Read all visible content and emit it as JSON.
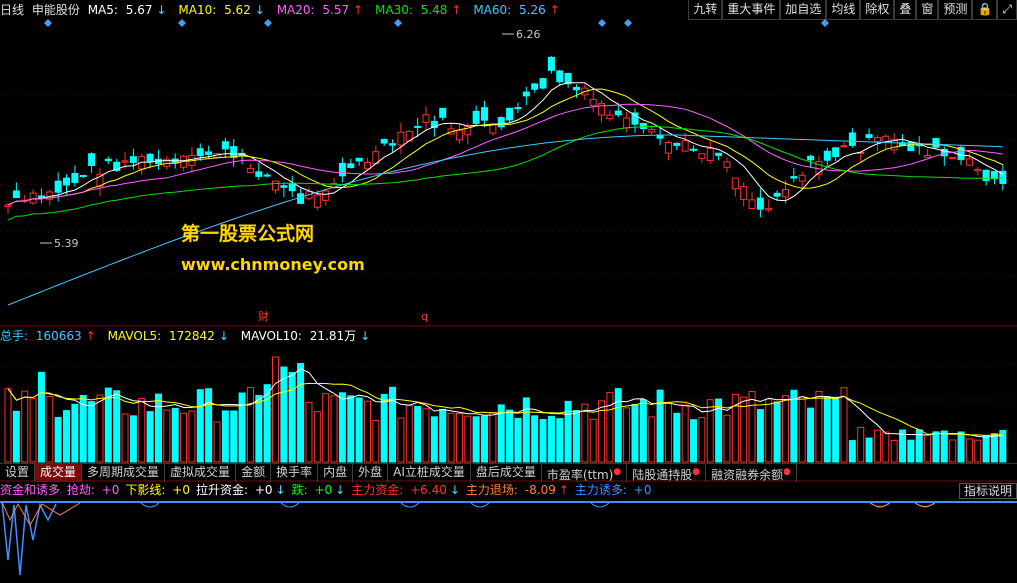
{
  "header": {
    "period": "日线",
    "stock_name": "申能股份",
    "ma5": {
      "label": "MA5:",
      "value": "5.67",
      "arrow": "↓",
      "color": "#ffffff"
    },
    "ma10": {
      "label": "MA10:",
      "value": "5.62",
      "arrow": "↓",
      "color": "#ffff00"
    },
    "ma20": {
      "label": "MA20:",
      "value": "5.57",
      "arrow": "↑",
      "color": "#ff60ff"
    },
    "ma30": {
      "label": "MA30:",
      "value": "5.48",
      "arrow": "↑",
      "color": "#00e000"
    },
    "ma60": {
      "label": "MA60:",
      "value": "5.26",
      "arrow": "↑",
      "color": "#40c8ff"
    }
  },
  "toolbar": [
    "九转",
    "重大事件",
    "加自选",
    "均线",
    "除权",
    "叠",
    "窗",
    "预测",
    "🔒",
    "⤢"
  ],
  "price_chart": {
    "high_label": "6.26",
    "low_label": "5.39",
    "event_marks": [
      "财",
      "q"
    ]
  },
  "watermark": {
    "line1": "第一股票公式网",
    "line2": "www.chnmoney.com"
  },
  "volume_header": {
    "total_label": "总手:",
    "total_value": "160663",
    "total_arrow": "↑",
    "mavol5_label": "MAVOL5:",
    "mavol5_value": "172842",
    "mavol5_arrow": "↓",
    "mavol10_label": "MAVOL10:",
    "mavol10_value": "21.81万",
    "mavol10_arrow": "↓"
  },
  "tabs": [
    {
      "label": "设置",
      "active": false,
      "dot": false
    },
    {
      "label": "成交量",
      "active": true,
      "dot": false
    },
    {
      "label": "多周期成交量",
      "active": false,
      "dot": false
    },
    {
      "label": "虚拟成交量",
      "active": false,
      "dot": false
    },
    {
      "label": "金额",
      "active": false,
      "dot": false
    },
    {
      "label": "换手率",
      "active": false,
      "dot": false
    },
    {
      "label": "内盘",
      "active": false,
      "dot": false
    },
    {
      "label": "外盘",
      "active": false,
      "dot": false
    },
    {
      "label": "AI立桩成交量",
      "active": false,
      "dot": false
    },
    {
      "label": "盘后成交量",
      "active": false,
      "dot": false
    },
    {
      "label": "市盈率(ttm)",
      "active": false,
      "dot": true
    },
    {
      "label": "陆股通持股",
      "active": false,
      "dot": true
    },
    {
      "label": "融资融券余额",
      "active": false,
      "dot": true
    }
  ],
  "indicator": {
    "name": "资金和诱多",
    "items": [
      {
        "label": "抢劫:",
        "value": "+0",
        "arrow": "",
        "color": "#ff60ff"
      },
      {
        "label": "下影线:",
        "value": "+0",
        "arrow": "",
        "color": "#ffff00"
      },
      {
        "label": "拉升资金:",
        "value": "+0",
        "arrow": "↓",
        "color": "#ffffff"
      },
      {
        "label": "跌:",
        "value": "+0",
        "arrow": "↓",
        "color": "#00ff00"
      },
      {
        "label": "主力资金:",
        "value": "+6.40",
        "arrow": "↓",
        "color": "#ff3030"
      },
      {
        "label": "主力退场:",
        "value": "-8.09",
        "arrow": "↑",
        "color": "#ff8040"
      },
      {
        "label": "主力诱多:",
        "value": "+0",
        "arrow": "",
        "color": "#4090ff"
      }
    ],
    "help_label": "指标说明"
  },
  "colors": {
    "up": "#ff3030",
    "down": "#00ffff",
    "grid": "#7a0a0a",
    "ma5": "#ffffff",
    "ma10": "#ffff00",
    "ma20": "#ff60ff",
    "ma30": "#00e000",
    "ma60": "#40c8ff"
  }
}
